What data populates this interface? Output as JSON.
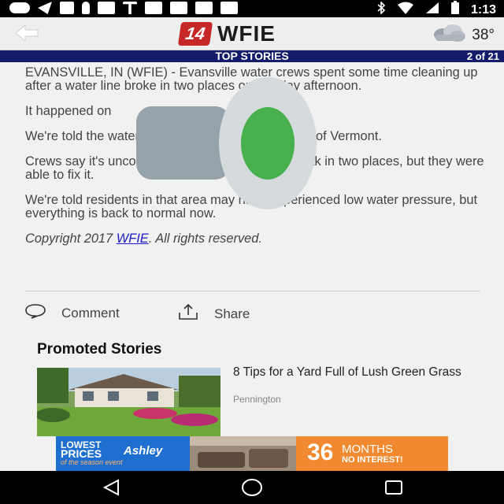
{
  "status_bar": {
    "time": "1:13"
  },
  "header": {
    "logo_number": "14",
    "logo_text": "WFIE",
    "temperature": "38°"
  },
  "section": {
    "title": "TOP STORIES",
    "counter": "2 of 21"
  },
  "article": {
    "paragraphs": [
      "EVANSVILLE, IN (WFIE) - Evansville water crews spent some time cleaning up after a water line broke in two places on Sunday afternoon.",
      "It happened on",
      "We're told the water line broke in two places North of Vermont.",
      "Crews say it's uncommon for the same line to break in two places, but they were able to fix it.",
      "We're told residents in that area may have experienced low water pressure, but everything is back to normal now."
    ],
    "copyright_prefix": "Copyright 2017 ",
    "copyright_link": "WFIE",
    "copyright_suffix": ". All rights reserved."
  },
  "actions": {
    "comment": "Comment",
    "share": "Share"
  },
  "promoted": {
    "title": "Promoted Stories",
    "item": {
      "headline": "8 Tips for a Yard Full of Lush Green Grass",
      "source": "Pennington"
    }
  },
  "ad": {
    "line1": "LOWEST",
    "line2": "PRICES",
    "line3": "of the season event",
    "brand": "Ashley",
    "promo_number": "36",
    "promo_unit": "MONTHS",
    "promo_sub": "NO INTEREST!"
  },
  "colors": {
    "section_bar": "#141b6b",
    "logo_red": "#c62828",
    "link": "#1a1acb"
  },
  "icons": {
    "back": "back-arrow-icon",
    "weather": "cloud-icon",
    "comment": "comment-bubble-icon",
    "share": "share-icon",
    "nav_back": "nav-back-icon",
    "nav_home": "nav-home-icon",
    "nav_recents": "nav-recents-icon",
    "overlay": "cylinder-overlay-icon"
  }
}
